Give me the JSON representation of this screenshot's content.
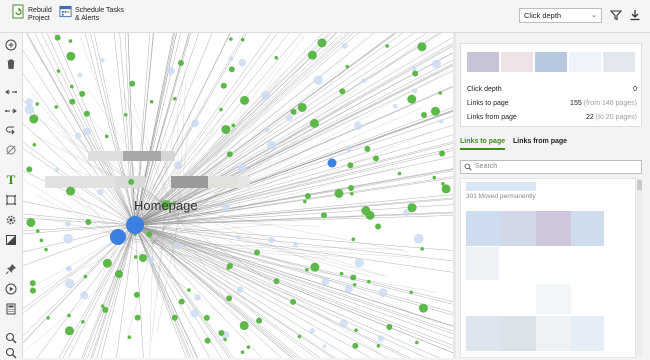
{
  "toolbar": {
    "rebuild_label": "Rebuild\nProject",
    "schedule_label": "Schedule Tasks\n& Alerts",
    "mode_select": "Click depth"
  },
  "graph": {
    "main_node_label": "Homepage"
  },
  "panel": {
    "stats": [
      {
        "label": "Click depth",
        "value": "0",
        "sub": ""
      },
      {
        "label": "Links to page",
        "value": "155",
        "sub": "(from 148 pages)"
      },
      {
        "label": "Links from page",
        "value": "22",
        "sub": "(to 20 pages)"
      }
    ],
    "tabs": [
      "Links to page",
      "Links from page"
    ],
    "search_placeholder": "Search",
    "first_item_status": "301 Moved permanently"
  },
  "colors": {
    "accent": "#3c8e1d",
    "node_green": "#5cb848",
    "node_blue": "#3b7fe0",
    "node_light_blue": "#c9d9f3",
    "swatches": [
      "#c9c3d8",
      "#efe3e8",
      "#b6c7e0",
      "#eef4fa",
      "#e3e8ef"
    ]
  }
}
